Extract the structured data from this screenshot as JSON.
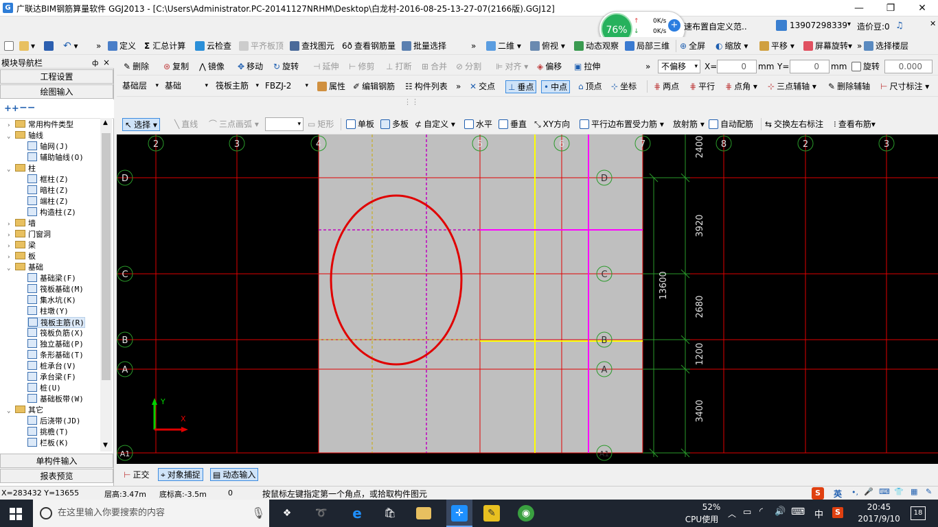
{
  "window": {
    "title": "广联达BIM钢筋算量软件 GGJ2013 - [C:\\Users\\Administrator.PC-20141127NRHM\\Desktop\\白龙村-2016-08-25-13-27-07(2166版).GGJ12]",
    "min": "—",
    "max": "❐",
    "close": "✕"
  },
  "perf": {
    "cpu_pct": "76%",
    "up": "0K/s",
    "down": "0K/s",
    "tip": "速布置自定义范.."
  },
  "account": {
    "phone": "13907298339",
    "credits": "造价豆:0"
  },
  "toolbar1": {
    "define": "定义",
    "sum": "汇总计算",
    "cloud": "云检查",
    "flat": "平齐板顶",
    "find": "查找图元",
    "view_rebar": "查看钢筋量",
    "batch": "批量选择",
    "view2d": "二维",
    "view_top": "俯视",
    "dynamic": "动态观察",
    "local3d": "局部三维",
    "fullscreen": "全屏",
    "zoom": "缩放",
    "pan": "平移",
    "rotate": "屏幕旋转",
    "floor": "选择楼层"
  },
  "toolbar2": {
    "delete": "删除",
    "copy": "复制",
    "mirror": "镜像",
    "move": "移动",
    "rotate": "旋转",
    "extend": "延伸",
    "trim": "修剪",
    "break": "打断",
    "merge": "合并",
    "split": "分割",
    "align": "对齐",
    "offset": "偏移",
    "stretch": "拉伸",
    "offset_mode": "不偏移",
    "x_label": "X=",
    "x_val": "0",
    "y_label": "Y=",
    "y_val": "0",
    "mm1": "mm",
    "mm2": "mm",
    "rotate_chk": "旋转",
    "rotate_val": "0.000"
  },
  "toolbar3": {
    "layer": "基础层",
    "cat": "基础",
    "type": "筏板主筋",
    "item": "FBZJ-2",
    "props": "属性",
    "edit": "编辑钢筋",
    "list": "构件列表",
    "snap_int": "交点",
    "snap_perp": "垂点",
    "snap_mid": "中点",
    "snap_vert": "顶点",
    "snap_coord": "坐标",
    "two_pts": "两点",
    "parallel": "平行",
    "pt_angle": "点角",
    "three_pt": "三点辅轴",
    "del_aux": "删除辅轴",
    "dim": "尺寸标注"
  },
  "toolbar4": {
    "select": "选择",
    "line": "直线",
    "arc": "三点画弧",
    "rect": "矩形",
    "single": "单板",
    "multi": "多板",
    "custom": "自定义",
    "horiz": "水平",
    "vert": "垂直",
    "xy": "XY方向",
    "parallel_edge": "平行边布置受力筋",
    "radial": "放射筋",
    "auto": "自动配筋",
    "swap": "交换左右标注",
    "view_bars": "查看布筋"
  },
  "nav": {
    "header": "模块导航栏",
    "pin": "ф",
    "close": "×",
    "project": "工程设置",
    "drawing": "绘图输入",
    "single": "单构件输入",
    "report": "报表预览",
    "tree": [
      {
        "label": "常用构件类型",
        "lvl": 0,
        "t": "f",
        "e": "›"
      },
      {
        "label": "轴线",
        "lvl": 0,
        "t": "f",
        "e": "⌄"
      },
      {
        "label": "轴网(J)",
        "lvl": 1,
        "t": "l"
      },
      {
        "label": "辅助轴线(O)",
        "lvl": 1,
        "t": "l"
      },
      {
        "label": "柱",
        "lvl": 0,
        "t": "f",
        "e": "⌄"
      },
      {
        "label": "框柱(Z)",
        "lvl": 1,
        "t": "l"
      },
      {
        "label": "暗柱(Z)",
        "lvl": 1,
        "t": "l"
      },
      {
        "label": "端柱(Z)",
        "lvl": 1,
        "t": "l"
      },
      {
        "label": "构造柱(Z)",
        "lvl": 1,
        "t": "l"
      },
      {
        "label": "墙",
        "lvl": 0,
        "t": "f",
        "e": "›"
      },
      {
        "label": "门窗洞",
        "lvl": 0,
        "t": "f",
        "e": "›"
      },
      {
        "label": "梁",
        "lvl": 0,
        "t": "f",
        "e": "›"
      },
      {
        "label": "板",
        "lvl": 0,
        "t": "f",
        "e": "›"
      },
      {
        "label": "基础",
        "lvl": 0,
        "t": "f",
        "e": "⌄"
      },
      {
        "label": "基础梁(F)",
        "lvl": 1,
        "t": "l"
      },
      {
        "label": "筏板基础(M)",
        "lvl": 1,
        "t": "l"
      },
      {
        "label": "集水坑(K)",
        "lvl": 1,
        "t": "l"
      },
      {
        "label": "柱墩(Y)",
        "lvl": 1,
        "t": "l"
      },
      {
        "label": "筏板主筋(R)",
        "lvl": 1,
        "t": "l",
        "sel": true
      },
      {
        "label": "筏板负筋(X)",
        "lvl": 1,
        "t": "l"
      },
      {
        "label": "独立基础(P)",
        "lvl": 1,
        "t": "l"
      },
      {
        "label": "条形基础(T)",
        "lvl": 1,
        "t": "l"
      },
      {
        "label": "桩承台(V)",
        "lvl": 1,
        "t": "l"
      },
      {
        "label": "承台梁(F)",
        "lvl": 1,
        "t": "l"
      },
      {
        "label": "桩(U)",
        "lvl": 1,
        "t": "l"
      },
      {
        "label": "基础板带(W)",
        "lvl": 1,
        "t": "l"
      },
      {
        "label": "其它",
        "lvl": 0,
        "t": "f",
        "e": "⌄"
      },
      {
        "label": "后浇带(JD)",
        "lvl": 1,
        "t": "l"
      },
      {
        "label": "挑檐(T)",
        "lvl": 1,
        "t": "l"
      },
      {
        "label": "栏板(K)",
        "lvl": 1,
        "t": "l"
      }
    ]
  },
  "canvas": {
    "axes_top": [
      "2",
      "3",
      "4",
      "5",
      "6",
      "7",
      "8",
      "2",
      "3"
    ],
    "axes_left": [
      "D",
      "C",
      "B",
      "A",
      "A1"
    ],
    "axes_mid": [
      "D",
      "C",
      "B",
      "A",
      "A1"
    ],
    "dims": [
      "2400",
      "3920",
      "2680",
      "1200",
      "3400"
    ],
    "total_dim": "13600",
    "ucs_x": "X",
    "ucs_y": "Y"
  },
  "bottombar": {
    "ortho": "正交",
    "snap": "对象捕捉",
    "dyn": "动态输入"
  },
  "status": {
    "coords": "X=283432  Y=13655",
    "floor_h": "层高:3.47m",
    "bottom_h": "底标高:-3.5m",
    "zero": "0",
    "hint": "按鼠标左键指定第一个角点，或拾取构件图元"
  },
  "tray": {
    "ime": "英",
    "ime2": "中",
    "cpu": "52%",
    "cpu_label": "CPU使用",
    "time": "20:45",
    "date": "2017/9/10",
    "notif": "18"
  },
  "taskbar": {
    "search": "在这里输入你要搜索的内容"
  },
  "colors": {
    "axis": "#e00000",
    "grid": "#2a9a2a",
    "slab": "#bfbfbf",
    "yellow": "#ffff00",
    "magenta": "#ff00ff"
  }
}
